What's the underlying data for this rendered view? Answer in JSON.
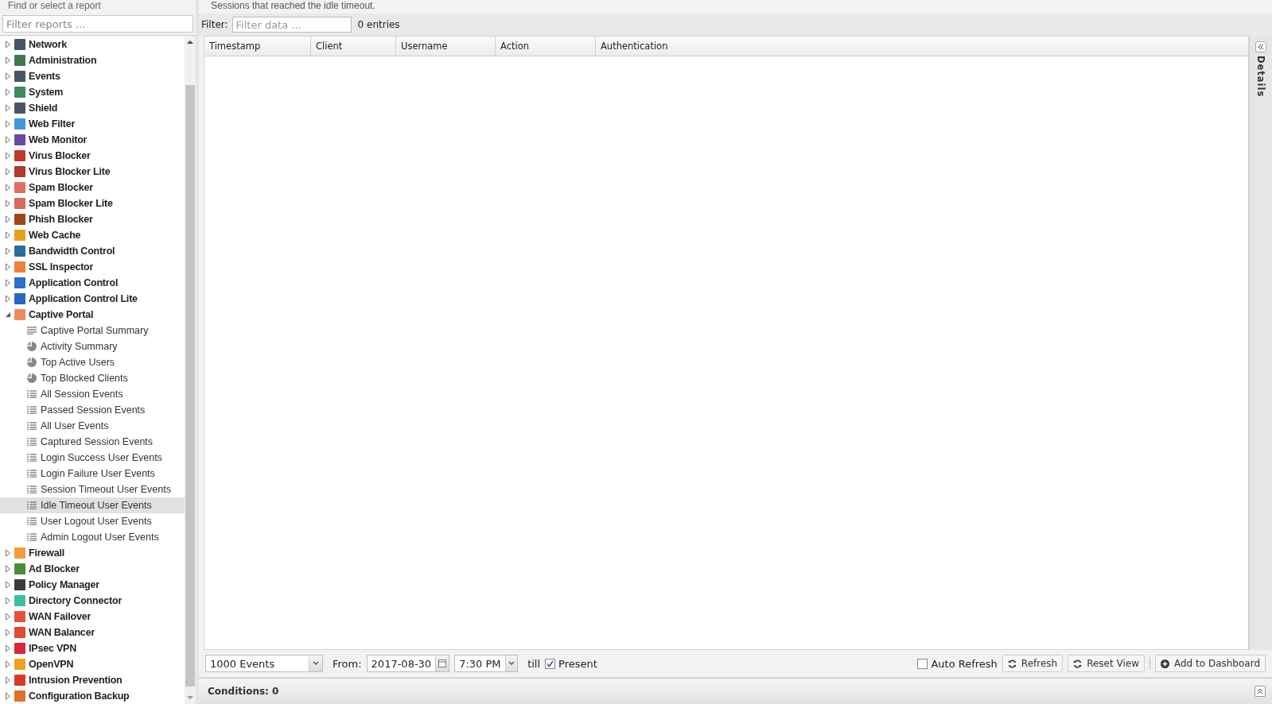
{
  "sidebar": {
    "title": "Find or select a report",
    "filter": {
      "placeholder": "Filter reports ..."
    },
    "categories": [
      {
        "label": "Network",
        "color": "#4a5568",
        "expanded": false
      },
      {
        "label": "Administration",
        "color": "#3f7a4e",
        "expanded": false
      },
      {
        "label": "Events",
        "color": "#4a5568",
        "expanded": false
      },
      {
        "label": "System",
        "color": "#3c8c5a",
        "expanded": false
      },
      {
        "label": "Shield",
        "color": "#4a5568",
        "expanded": false
      },
      {
        "label": "Web Filter",
        "color": "#3a9ad9",
        "expanded": false
      },
      {
        "label": "Web Monitor",
        "color": "#6b4aa5",
        "expanded": false
      },
      {
        "label": "Virus Blocker",
        "color": "#c0392b",
        "expanded": false
      },
      {
        "label": "Virus Blocker Lite",
        "color": "#b03a2e",
        "expanded": false
      },
      {
        "label": "Spam Blocker",
        "color": "#e07060",
        "expanded": false
      },
      {
        "label": "Spam Blocker Lite",
        "color": "#d96a5a",
        "expanded": false
      },
      {
        "label": "Phish Blocker",
        "color": "#a0441c",
        "expanded": false
      },
      {
        "label": "Web Cache",
        "color": "#e8a020",
        "expanded": false
      },
      {
        "label": "Bandwidth Control",
        "color": "#2a6f9a",
        "expanded": false
      },
      {
        "label": "SSL Inspector",
        "color": "#f07f3c",
        "expanded": false
      },
      {
        "label": "Application Control",
        "color": "#2d6fd1",
        "expanded": false
      },
      {
        "label": "Application Control Lite",
        "color": "#2a66c4",
        "expanded": false
      },
      {
        "label": "Captive Portal",
        "color": "#f08a5d",
        "expanded": true,
        "children": [
          {
            "label": "Captive Portal Summary",
            "kind": "text",
            "selected": false
          },
          {
            "label": "Activity Summary",
            "kind": "pie",
            "selected": false
          },
          {
            "label": "Top Active Users",
            "kind": "pie",
            "selected": false
          },
          {
            "label": "Top Blocked Clients",
            "kind": "pie",
            "selected": false
          },
          {
            "label": "All Session Events",
            "kind": "list",
            "selected": false
          },
          {
            "label": "Passed Session Events",
            "kind": "list",
            "selected": false
          },
          {
            "label": "All User Events",
            "kind": "list",
            "selected": false
          },
          {
            "label": "Captured Session Events",
            "kind": "list",
            "selected": false
          },
          {
            "label": "Login Success User Events",
            "kind": "list",
            "selected": false
          },
          {
            "label": "Login Failure User Events",
            "kind": "list",
            "selected": false
          },
          {
            "label": "Session Timeout User Events",
            "kind": "list",
            "selected": false
          },
          {
            "label": "Idle Timeout User Events",
            "kind": "list",
            "selected": true
          },
          {
            "label": "User Logout User Events",
            "kind": "list",
            "selected": false
          },
          {
            "label": "Admin Logout User Events",
            "kind": "list",
            "selected": false
          }
        ]
      },
      {
        "label": "Firewall",
        "color": "#f39c3c",
        "expanded": false
      },
      {
        "label": "Ad Blocker",
        "color": "#4c8c3c",
        "expanded": false
      },
      {
        "label": "Policy Manager",
        "color": "#3a3a3a",
        "expanded": false
      },
      {
        "label": "Directory Connector",
        "color": "#3cc0a0",
        "expanded": false
      },
      {
        "label": "WAN Failover",
        "color": "#e8503c",
        "expanded": false
      },
      {
        "label": "WAN Balancer",
        "color": "#e04a30",
        "expanded": false
      },
      {
        "label": "IPsec VPN",
        "color": "#d8283c",
        "expanded": false
      },
      {
        "label": "OpenVPN",
        "color": "#f0a020",
        "expanded": false
      },
      {
        "label": "Intrusion Prevention",
        "color": "#d83a2a",
        "expanded": false
      },
      {
        "label": "Configuration Backup",
        "color": "#e0702c",
        "expanded": false
      }
    ]
  },
  "report": {
    "description": "Sessions that reached the idle timeout.",
    "filter": {
      "label": "Filter:",
      "placeholder": "Filter data ..."
    },
    "entries": "0 entries",
    "columns": [
      "Timestamp",
      "Client",
      "Username",
      "Action",
      "Authentication"
    ],
    "details_label": "Details",
    "toolbar": {
      "limit": "1000 Events",
      "from_label": "From:",
      "date": "2017-08-30",
      "time": "7:30 PM",
      "till_label": "till",
      "present": {
        "label": "Present",
        "checked": true
      },
      "auto_refresh": {
        "label": "Auto Refresh",
        "checked": false
      },
      "buttons": [
        {
          "label": "Refresh",
          "kind": "refresh"
        },
        {
          "label": "Reset View",
          "kind": "refresh"
        },
        {
          "label": "Add to Dashboard",
          "kind": "add"
        }
      ]
    },
    "conditions": "Conditions: 0"
  }
}
